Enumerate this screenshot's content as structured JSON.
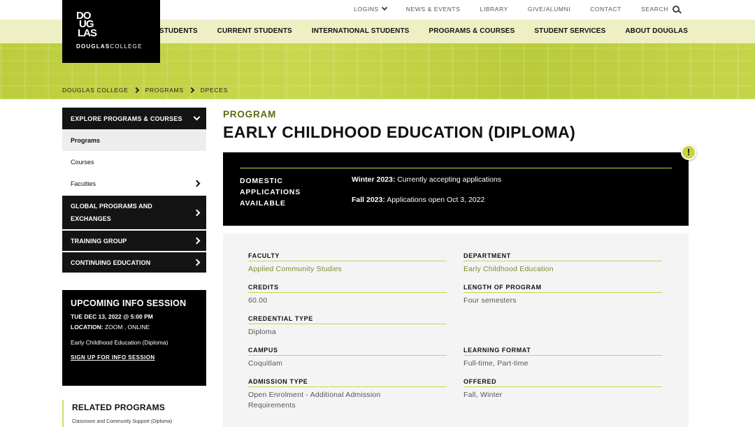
{
  "utility_nav": {
    "logins": "LOGINS",
    "news_events": "NEWS & EVENTS",
    "library": "LIBRARY",
    "give_alumni": "GIVE/ALUMNI",
    "contact": "CONTACT",
    "search": "SEARCH"
  },
  "logo": {
    "mark": "DOUGLAS",
    "word_strong": "DOUGLAS",
    "word_light": "COLLEGE"
  },
  "main_nav": [
    "FUTURE STUDENTS",
    "CURRENT STUDENTS",
    "INTERNATIONAL STUDENTS",
    "PROGRAMS & COURSES",
    "STUDENT SERVICES",
    "ABOUT DOUGLAS"
  ],
  "breadcrumb": [
    "DOUGLAS COLLEGE",
    "PROGRAMS",
    "DPECES"
  ],
  "sidebar": {
    "header": "EXPLORE PROGRAMS & COURSES",
    "items": [
      "Programs",
      "Courses",
      "Faculties"
    ],
    "sections": [
      "GLOBAL PROGRAMS AND EXCHANGES",
      "TRAINING GROUP",
      "CONTINUING EDUCATION"
    ]
  },
  "info_session": {
    "title": "UPCOMING INFO SESSION",
    "datetime": "TUE DEC 13, 2022 @ 5:00 PM",
    "location_label": "LOCATION:",
    "location_value": " ZOOM , ONLINE",
    "program": "Early Childhood Education (Diploma)",
    "signup": "SIGN UP FOR INFO SESSION"
  },
  "related": {
    "title": "RELATED PROGRAMS",
    "first": "Classroom and Community Support (Diploma)"
  },
  "program": {
    "kicker": "PROGRAM",
    "title": "EARLY CHILDHOOD EDUCATION (DIPLOMA)"
  },
  "applications": {
    "label": "DOMESTIC APPLICATIONS AVAILABLE",
    "row1_term": "Winter 2023:",
    "row1_text": " Currently accepting applications",
    "row2_term": "Fall 2023:",
    "row2_text": " Applications open Oct 3, 2022",
    "alert_icon": "!"
  },
  "details": {
    "faculty": {
      "label": "FACULTY",
      "value": "Applied Community Studies"
    },
    "department": {
      "label": "DEPARTMENT",
      "value": "Early Childhood Education"
    },
    "credits": {
      "label": "CREDITS",
      "value": "60.00"
    },
    "length": {
      "label": "LENGTH OF PROGRAM",
      "value": "Four semesters"
    },
    "credential": {
      "label": "CREDENTIAL TYPE",
      "value": "Diploma"
    },
    "campus": {
      "label": "CAMPUS",
      "value": "Coquitlam"
    },
    "format": {
      "label": "LEARNING FORMAT",
      "value": "Full-time, Part-time"
    },
    "admission": {
      "label": "ADMISSION TYPE",
      "value": "Open Enrolment - Additional Admission Requirements"
    },
    "offered": {
      "label": "OFFERED",
      "value": "Fall, Winter"
    }
  }
}
